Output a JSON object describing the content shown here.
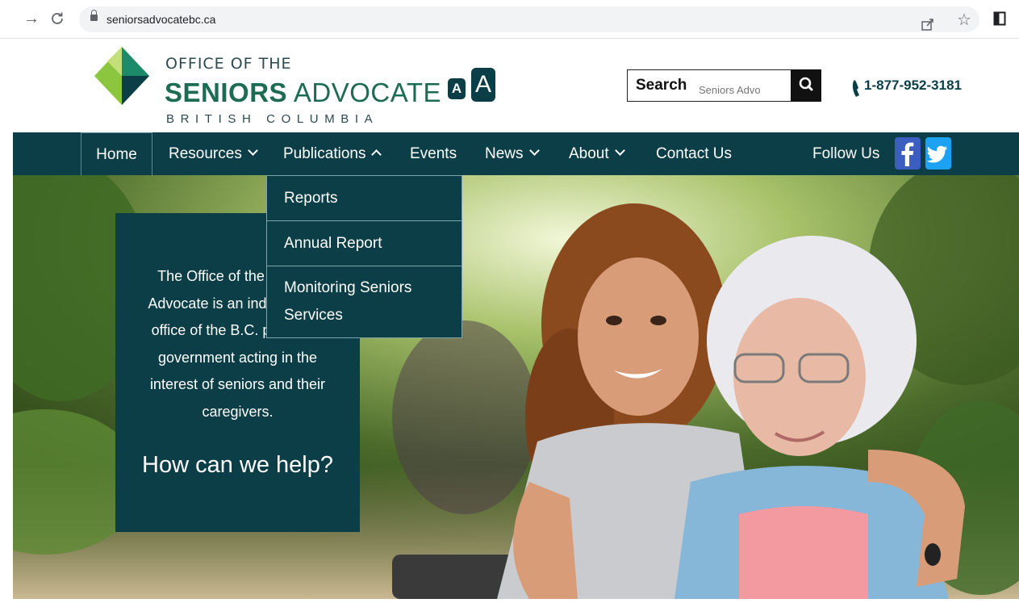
{
  "browser": {
    "url": "seniorsadvocatebc.ca"
  },
  "logo": {
    "line1": "OFFICE OF THE",
    "line2_bold": "SENIORS",
    "line2_light": "ADVOCATE",
    "line3": "BRITISH COLUMBIA"
  },
  "font_size": {
    "small_label": "A",
    "large_label": "A"
  },
  "search": {
    "label": "Search",
    "placeholder": "Seniors Advo"
  },
  "phone": {
    "number": "1-877-952-3181"
  },
  "nav": {
    "home": "Home",
    "resources": "Resources",
    "publications": "Publications",
    "events": "Events",
    "news": "News",
    "about": "About",
    "contact": "Contact Us",
    "follow": "Follow Us"
  },
  "dropdown": {
    "items": [
      "Reports",
      "Annual Report",
      "Monitoring Seniors Services"
    ]
  },
  "info_box": {
    "text": "The Office of the Seniors Advocate is an independent office of the B.C. provincial government acting in the interest of seniors and their caregivers.",
    "cta": "How can we help?"
  },
  "colors": {
    "brand_teal": "#0c3e48",
    "logo_green": "#1d6b53"
  },
  "icons": {
    "back": "arrow-right-icon",
    "reload": "reload-icon",
    "lock": "lock-icon",
    "share": "share-icon",
    "star": "star-icon",
    "sidebar": "sidebar-icon",
    "search": "search-icon",
    "phone": "phone-icon",
    "facebook": "facebook-icon",
    "twitter": "twitter-icon"
  }
}
